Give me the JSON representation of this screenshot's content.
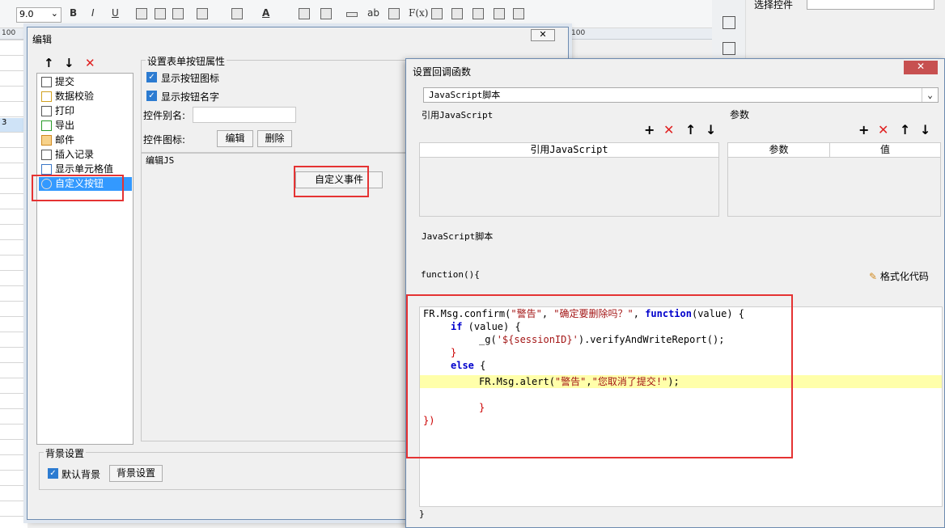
{
  "toolbar": {
    "font_size": "9.0",
    "bold": "B",
    "italic": "I",
    "underline": "U",
    "ab": "ab",
    "fx": "F(x)",
    "text_color": "A"
  },
  "ruler": {
    "mark0": "100",
    "mark1": "100"
  },
  "row_label": "3",
  "right_pane": {
    "select_label": "选择控件"
  },
  "dialog1": {
    "title": "编辑",
    "tree": [
      {
        "label": "提交"
      },
      {
        "label": "数据校验"
      },
      {
        "label": "打印"
      },
      {
        "label": "导出"
      },
      {
        "label": "邮件"
      },
      {
        "label": "插入记录"
      },
      {
        "label": "显示单元格值"
      },
      {
        "label": "自定义按钮"
      }
    ],
    "props": {
      "legend": "设置表单按钮属性",
      "show_icon": "显示按钮图标",
      "show_name": "显示按钮名字",
      "alias_label": "控件别名:",
      "icon_label": "控件图标:",
      "edit_btn": "编辑",
      "delete_btn": "删除"
    },
    "edit_js": {
      "legend": "编辑JS",
      "custom_event_btn": "自定义事件"
    },
    "background": {
      "legend": "背景设置",
      "default_bg": "默认背景",
      "bg_btn": "背景设置"
    }
  },
  "dialog2": {
    "title": "设置回调函数",
    "type_select": "JavaScript脚本",
    "ref_section": "引用JavaScript",
    "ref_col": "引用JavaScript",
    "param_section": "参数",
    "param_col": "参数",
    "value_col": "值",
    "script_section": "JavaScript脚本",
    "func_open": "function(){",
    "format_btn": "格式化代码",
    "func_close": "}",
    "code": {
      "l1_a": "FR.Msg.confirm(",
      "l1_b": "\"警告\"",
      "l1_c": ", ",
      "l1_d": "\"确定要删除吗？\"",
      "l1_e": ", ",
      "l1_f": "function",
      "l1_g": "(value) {",
      "l2_a": "if",
      "l2_b": " (value) {",
      "l3_a": "_g(",
      "l3_b": "'${sessionID}'",
      "l3_c": ").verifyAndWriteReport();",
      "l4": "}",
      "l5_a": "else",
      "l5_b": " {",
      "l6_a": "FR.Msg.alert(",
      "l6_b": "\"警告\"",
      "l6_c": ",",
      "l6_d": "\"您取消了提交!\"",
      "l6_e": ");",
      "l8": "}",
      "l9": "})"
    }
  }
}
